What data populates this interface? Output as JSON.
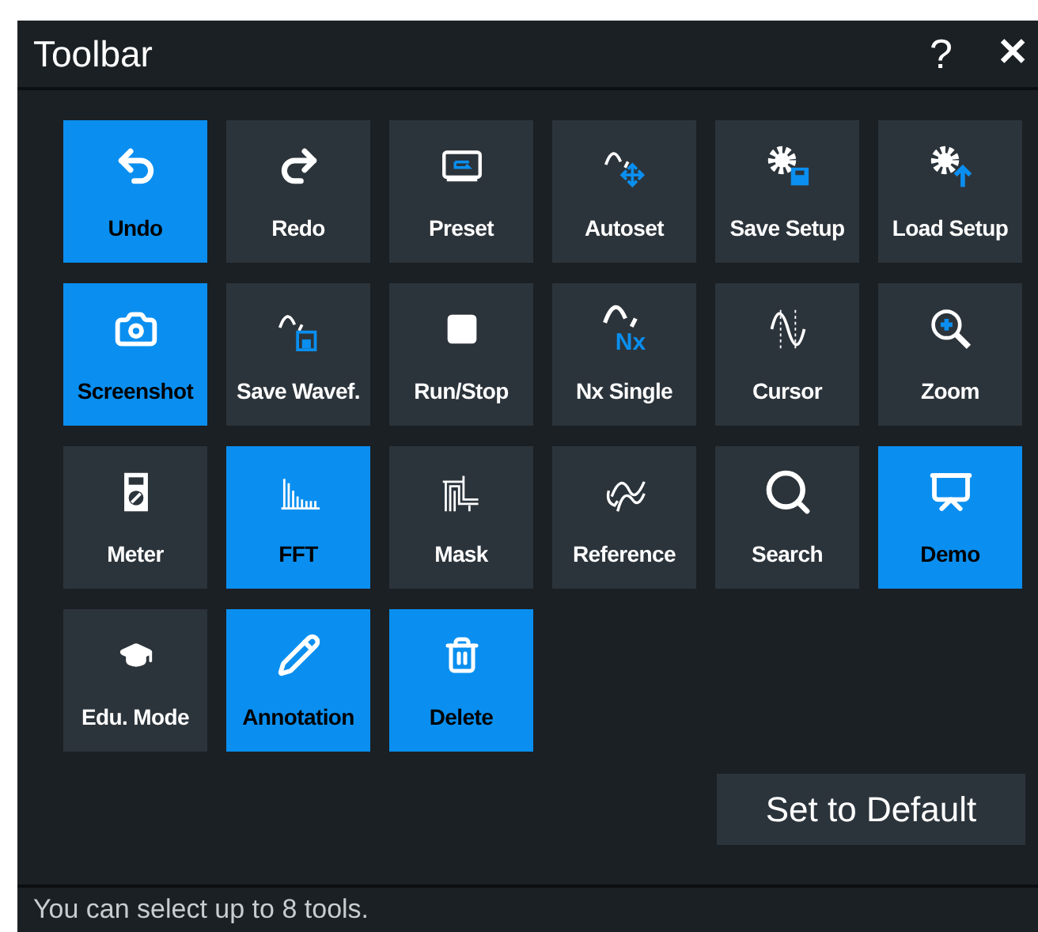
{
  "window": {
    "title": "Toolbar",
    "help": "?",
    "close": "✕"
  },
  "tools": [
    {
      "label": "Undo",
      "selected": true
    },
    {
      "label": "Redo",
      "selected": false
    },
    {
      "label": "Preset",
      "selected": false
    },
    {
      "label": "Autoset",
      "selected": false
    },
    {
      "label": "Save Setup",
      "selected": false
    },
    {
      "label": "Load Setup",
      "selected": false
    },
    {
      "label": "Screenshot",
      "selected": true
    },
    {
      "label": "Save Wavef.",
      "selected": false
    },
    {
      "label": "Run/Stop",
      "selected": false
    },
    {
      "label": "Nx Single",
      "selected": false,
      "icon_text": "Nx"
    },
    {
      "label": "Cursor",
      "selected": false
    },
    {
      "label": "Zoom",
      "selected": false
    },
    {
      "label": "Meter",
      "selected": false
    },
    {
      "label": "FFT",
      "selected": true
    },
    {
      "label": "Mask",
      "selected": false
    },
    {
      "label": "Reference",
      "selected": false
    },
    {
      "label": "Search",
      "selected": false
    },
    {
      "label": "Demo",
      "selected": true
    },
    {
      "label": "Edu. Mode",
      "selected": false
    },
    {
      "label": "Annotation",
      "selected": true
    },
    {
      "label": "Delete",
      "selected": true
    }
  ],
  "default_button": "Set to Default",
  "status_bar": "You can select up to 8 tools."
}
